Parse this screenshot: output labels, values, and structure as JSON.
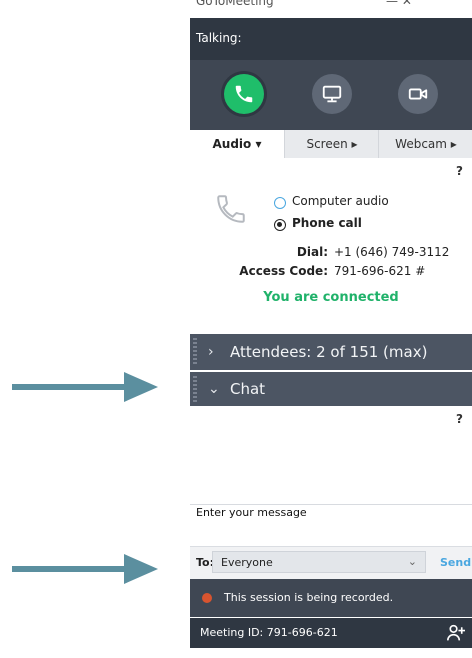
{
  "window": {
    "title": "GoToMeeting",
    "controls": "—  ✕"
  },
  "talking": {
    "label": "Talking:"
  },
  "toolbar": {
    "phone_icon": "phone-icon",
    "screen_icon": "monitor-icon",
    "webcam_icon": "video-camera-icon",
    "phone_color": "#1fbe6a"
  },
  "tabs": {
    "audio": "Audio ▾",
    "screen": "Screen ▸",
    "webcam": "Webcam ▸"
  },
  "audio": {
    "help": "?",
    "computer_audio": "Computer audio",
    "phone_call": "Phone call",
    "selected": "Phone call",
    "dial_label": "Dial:",
    "dial_value": "+1 (646) 749-3112",
    "access_label": "Access Code:",
    "access_value": "791-696-621 #",
    "status": "You are connected",
    "status_color": "#20b26a"
  },
  "attendees": {
    "arrow": "›",
    "label": "Attendees: 2 of 151 (max)"
  },
  "chat": {
    "arrow": "⌄",
    "label": "Chat",
    "help": "?",
    "message_label": "Enter your message",
    "to_label": "To:",
    "to_value": "Everyone",
    "chevron": "⌄",
    "send": "Send"
  },
  "recording": {
    "text": "This session is being recorded.",
    "dot_color": "#d8542f"
  },
  "meeting": {
    "id_text": "Meeting ID: 791-696-621",
    "add_icon": "add-person-icon"
  },
  "annotations": {
    "arrow_color": "#5b8f9f"
  }
}
